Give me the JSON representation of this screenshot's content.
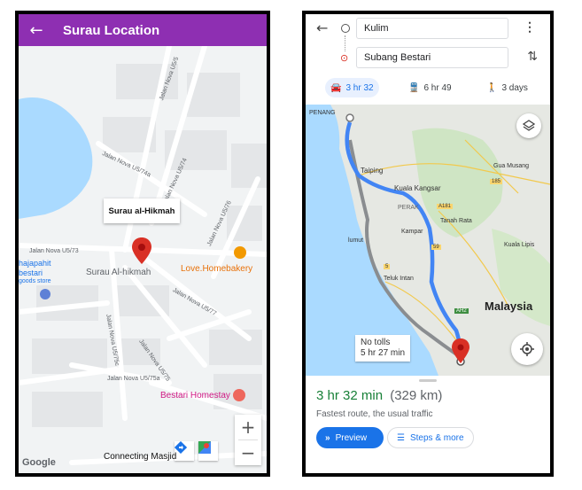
{
  "left": {
    "appbar": {
      "title": "Surau Location",
      "back_icon": "arrow-left-icon",
      "color": "#8e2fb2"
    },
    "map": {
      "info_window": "Surau al-Hikmah",
      "place_label": "Surau Al-hikmah",
      "poi_bakery": "Love.Homebakery",
      "poi_homestay": "Bestari Homestay",
      "area_labels": [
        "hajapahit",
        "bestari",
        "goods store"
      ],
      "bottom_label": "Connecting Masjid",
      "google_logo": "Google",
      "streets": [
        "Jalan Nova U5/5",
        "Jalan Nova U5/74a",
        "Jalan Nova U5/74",
        "Jalan Nova U5/76",
        "Jalan Nova U5/73",
        "Jalan Nova U5/77",
        "Jalan Nova U5/75c",
        "Jalan Nova U5/75",
        "Jalan Nova U5/75a"
      ],
      "zoom_in": "+",
      "zoom_out": "−"
    }
  },
  "right": {
    "origin": "Kulim",
    "destination": "Subang Bestari",
    "modes": [
      {
        "icon": "car-icon",
        "label": "3 hr 32",
        "active": true
      },
      {
        "icon": "train-icon",
        "label": "6 hr 49",
        "active": false
      },
      {
        "icon": "walk-icon",
        "label": "3 days",
        "active": false
      }
    ],
    "map": {
      "places": [
        "PENANG",
        "Taiping",
        "Kuala Kangsar",
        "PERAK",
        "Tanah Rata",
        "Kampar",
        "Teluk Intan",
        "lumut",
        "Gua Musang",
        "Kuala Lipis",
        "Malaysia"
      ],
      "road_codes": [
        "A181",
        "185",
        "59",
        "5",
        "AH2"
      ],
      "alt_route_line1": "No tolls",
      "alt_route_line2": "5 hr 27 min"
    },
    "summary": {
      "time": "3 hr 32 min",
      "distance": "(329 km)",
      "subtitle": "Fastest route, the usual traffic",
      "preview": "Preview",
      "steps": "Steps & more"
    },
    "accent": "#1a73e8"
  }
}
